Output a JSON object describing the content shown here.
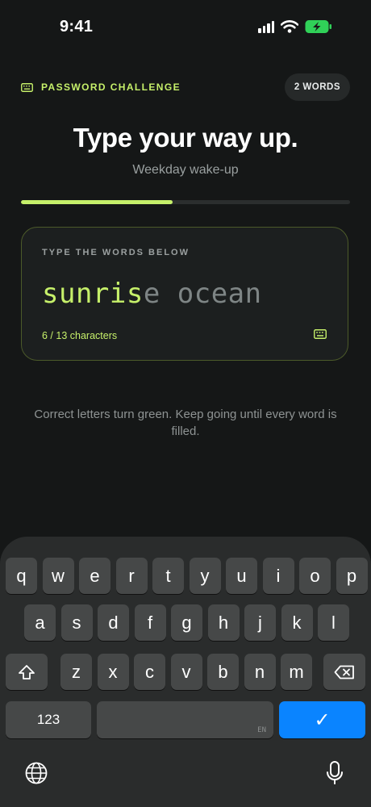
{
  "status": {
    "time": "9:41"
  },
  "header": {
    "challenge_label": "PASSWORD CHALLENGE",
    "word_count": "2 WORDS"
  },
  "title": "Type your way up.",
  "subtitle": "Weekday wake-up",
  "progress": {
    "fraction": 0.46
  },
  "card": {
    "label": "TYPE THE WORDS BELOW",
    "typed": "sunris",
    "remaining": "e ocean",
    "count": "6 / 13 characters"
  },
  "hint": "Correct letters turn green. Keep going until every word is filled.",
  "keyboard": {
    "row1": [
      "q",
      "w",
      "e",
      "r",
      "t",
      "y",
      "u",
      "i",
      "o",
      "p"
    ],
    "row2": [
      "a",
      "s",
      "d",
      "f",
      "g",
      "h",
      "j",
      "k",
      "l"
    ],
    "row3": [
      "z",
      "x",
      "c",
      "v",
      "b",
      "n",
      "m"
    ],
    "numbers_label": "123",
    "space_lang": "EN",
    "return_symbol": "✓"
  },
  "colors": {
    "accent": "#c6f06a",
    "background": "#151717",
    "keyboard_bg": "#2a2c2c",
    "key_bg": "#464848",
    "return_blue": "#0a84ff"
  },
  "icons": [
    "signal-icon",
    "wifi-icon",
    "battery-charging-icon",
    "keyboard-icon",
    "shift-icon",
    "delete-icon",
    "globe-icon",
    "microphone-icon"
  ]
}
